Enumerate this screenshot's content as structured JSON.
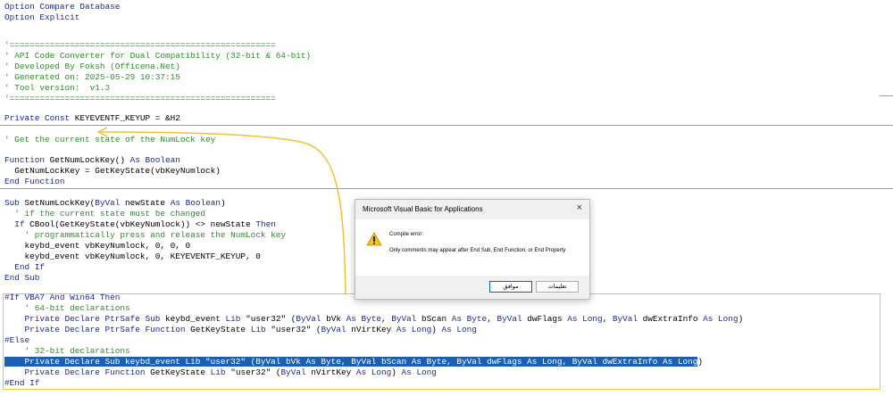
{
  "code": {
    "lines": [
      [
        {
          "t": "Option Compare Database",
          "c": "kw"
        }
      ],
      [
        {
          "t": "Option Explicit",
          "c": "kw"
        }
      ],
      [
        {
          "t": "'=====================================================",
          "c": "cm"
        }
      ],
      [
        {
          "t": "' API Code Converter for Dual Compatibility (32-bit & 64-bit)",
          "c": "cm"
        }
      ],
      [
        {
          "t": "' Developed By Foksh (Officena.Net)",
          "c": "cm"
        }
      ],
      [
        {
          "t": "' Generated on: 2025-05-29 10:37:15",
          "c": "cm"
        }
      ],
      [
        {
          "t": "' Tool version:  v1.3",
          "c": "cm"
        }
      ],
      [
        {
          "t": "'=====================================================",
          "c": "cm"
        }
      ],
      [
        {
          "t": "Private Const",
          "c": "kw"
        },
        {
          "t": " KEYEVENTF_KEYUP = &H2"
        }
      ],
      [
        {
          "t": "' Get the current state of the NumLock key",
          "c": "cm"
        }
      ],
      [
        {
          "t": "Function",
          "c": "kw"
        },
        {
          "t": " GetNumLockKey() "
        },
        {
          "t": "As Boolean",
          "c": "kw"
        }
      ],
      [
        {
          "t": "  GetNumLockKey = GetKeyState(vbKeyNumlock)"
        }
      ],
      [
        {
          "t": "End Function",
          "c": "kw"
        }
      ],
      [
        {
          "t": "Sub",
          "c": "kw"
        },
        {
          "t": " SetNumLockKey("
        },
        {
          "t": "ByVal",
          "c": "kw"
        },
        {
          "t": " newState "
        },
        {
          "t": "As Boolean",
          "c": "kw"
        },
        {
          "t": ")"
        }
      ],
      [
        {
          "t": "  ' if the current state must be changed",
          "c": "cm"
        }
      ],
      [
        {
          "t": "  If",
          "c": "kw"
        },
        {
          "t": " CBool(GetKeyState(vbKeyNumlock)) <> newState "
        },
        {
          "t": "Then",
          "c": "kw"
        }
      ],
      [
        {
          "t": "    ' programmatically press and release the NumLock key",
          "c": "cm"
        }
      ],
      [
        {
          "t": "    keybd_event vbKeyNumlock, 0, 0, 0"
        }
      ],
      [
        {
          "t": "    keybd_event vbKeyNumlock, 0, KEYEVENTF_KEYUP, 0"
        }
      ],
      [
        {
          "t": "  End If",
          "c": "kw"
        }
      ],
      [
        {
          "t": "End Sub",
          "c": "kw"
        }
      ],
      [
        {
          "t": "#If VBA7 And Win64 Then",
          "c": "kw"
        }
      ],
      [
        {
          "t": "    ' 64-bit declarations",
          "c": "cm"
        }
      ],
      [
        {
          "t": "    Private Declare PtrSafe Sub",
          "c": "kw"
        },
        {
          "t": " keybd_event "
        },
        {
          "t": "Lib",
          "c": "kw"
        },
        {
          "t": " \"user32\" ("
        },
        {
          "t": "ByVal",
          "c": "kw"
        },
        {
          "t": " bVk "
        },
        {
          "t": "As Byte",
          "c": "kw"
        },
        {
          "t": ", "
        },
        {
          "t": "ByVal",
          "c": "kw"
        },
        {
          "t": " bScan "
        },
        {
          "t": "As Byte",
          "c": "kw"
        },
        {
          "t": ", "
        },
        {
          "t": "ByVal",
          "c": "kw"
        },
        {
          "t": " dwFlags "
        },
        {
          "t": "As Long",
          "c": "kw"
        },
        {
          "t": ", "
        },
        {
          "t": "ByVal",
          "c": "kw"
        },
        {
          "t": " dwExtraInfo "
        },
        {
          "t": "As Long",
          "c": "kw"
        },
        {
          "t": ")"
        }
      ],
      [
        {
          "t": "    Private Declare PtrSafe Function",
          "c": "kw"
        },
        {
          "t": " GetKeyState "
        },
        {
          "t": "Lib",
          "c": "kw"
        },
        {
          "t": " \"user32\" ("
        },
        {
          "t": "ByVal",
          "c": "kw"
        },
        {
          "t": " nVirtKey "
        },
        {
          "t": "As Long",
          "c": "kw"
        },
        {
          "t": ") "
        },
        {
          "t": "As Long",
          "c": "kw"
        }
      ],
      [
        {
          "t": "#Else",
          "c": "kw"
        }
      ],
      [
        {
          "t": "    ' 32-bit declarations",
          "c": "cm"
        }
      ],
      [
        {
          "t": "    Private Declare Sub keybd_event Lib \"user32\" (ByVal bVk As Byte, ByVal bScan As Byte, ByVal dwFlags As Long, ByVal dwExtraInfo As Long",
          "c": "sel"
        },
        {
          "t": ")"
        }
      ],
      [
        {
          "t": "    Private Declare Function",
          "c": "kw"
        },
        {
          "t": " GetKeyState "
        },
        {
          "t": "Lib",
          "c": "kw"
        },
        {
          "t": " \"user32\" ("
        },
        {
          "t": "ByVal",
          "c": "kw"
        },
        {
          "t": " nVirtKey "
        },
        {
          "t": "As Long",
          "c": "kw"
        },
        {
          "t": ") "
        },
        {
          "t": "As Long",
          "c": "kw"
        }
      ],
      [
        {
          "t": "#End If",
          "c": "kw"
        }
      ]
    ]
  },
  "dialog": {
    "title": "Microsoft Visual Basic for Applications",
    "close": "×",
    "heading": "Compile error:",
    "message": "Only comments may appear after End Sub, End Function, or End Property",
    "ok_label": "موافق",
    "help_label": "تعليمات",
    "icon": "warning-icon"
  },
  "colors": {
    "keyword": "#1a2a9a",
    "comment": "#2e8b2e",
    "selection": "#1a5fb4",
    "annotation": "#f2c233"
  }
}
